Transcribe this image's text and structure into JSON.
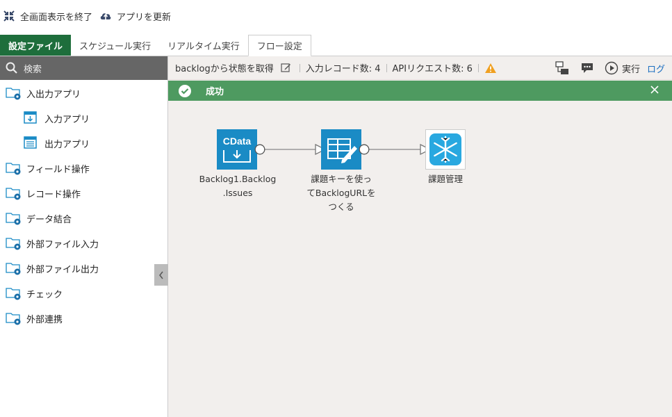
{
  "topbar": {
    "exit_fullscreen": "全画面表示を終了",
    "update_app": "アプリを更新"
  },
  "tabs": [
    {
      "label": "設定ファイル"
    },
    {
      "label": "スケジュール実行"
    },
    {
      "label": "リアルタイム実行"
    },
    {
      "label": "フロー設定"
    }
  ],
  "sidebar": {
    "search_placeholder": "検索",
    "items": [
      {
        "label": "入出力アプリ"
      },
      {
        "label": "入力アプリ"
      },
      {
        "label": "出力アプリ"
      },
      {
        "label": "フィールド操作"
      },
      {
        "label": "レコード操作"
      },
      {
        "label": "データ結合"
      },
      {
        "label": "外部ファイル入力"
      },
      {
        "label": "外部ファイル出力"
      },
      {
        "label": "チェック"
      },
      {
        "label": "外部連携"
      }
    ]
  },
  "flow_toolbar": {
    "flow_name": "backlogから状態を取得",
    "input_records": "入力レコード数: 4",
    "api_requests": "APIリクエスト数: 6",
    "run_label": "実行",
    "log_label": "ログ"
  },
  "status": {
    "message": "成功",
    "color": "#4e9a60"
  },
  "nodes": [
    {
      "icon_text": "CData",
      "label_line1": "Backlog1.Backlog",
      "label_line2": ".Issues"
    },
    {
      "label_line1": "課題キーを使っ",
      "label_line2": "てBacklogURLを",
      "label_line3": "つくる"
    },
    {
      "label_line1": "課題管理"
    }
  ],
  "colors": {
    "accent_green": "#1e6e3c",
    "node_blue": "#1a8bc5",
    "warning": "#f0a020"
  }
}
